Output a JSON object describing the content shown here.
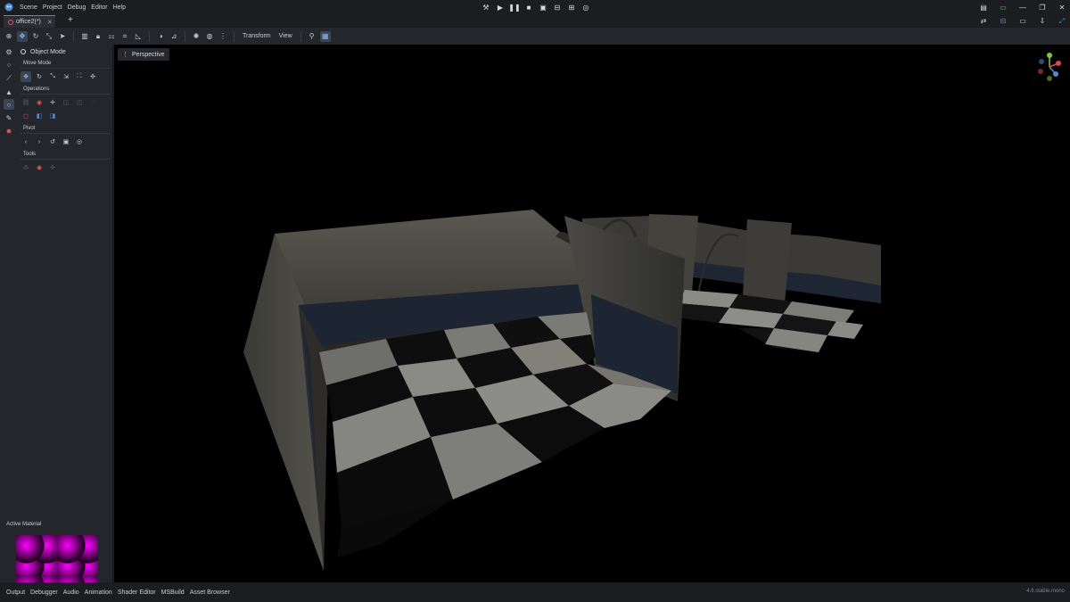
{
  "menubar": {
    "items": [
      "Scene",
      "Project",
      "Debug",
      "Editor",
      "Help"
    ]
  },
  "tabs": {
    "scene_tab": "office2(*)",
    "add": "+"
  },
  "toolbar": {
    "transform_label": "Transform",
    "view_label": "View"
  },
  "sidepanel": {
    "mode_label": "Object Mode",
    "move_mode_label": "Move Mode",
    "operations_label": "Operations",
    "pivot_label": "Pivot",
    "tools_label": "Tools",
    "active_material_label": "Active Material"
  },
  "viewport": {
    "perspective_label": "Perspective"
  },
  "bottom": {
    "tabs": [
      "Output",
      "Debugger",
      "Audio",
      "Animation",
      "Shader Editor",
      "MSBuild",
      "Asset Browser"
    ],
    "version": "4.6.stable.mono"
  },
  "colors": {
    "accent": "#4a8cd6",
    "error": "#e05a5a",
    "material_magenta": "#ff00ff"
  }
}
